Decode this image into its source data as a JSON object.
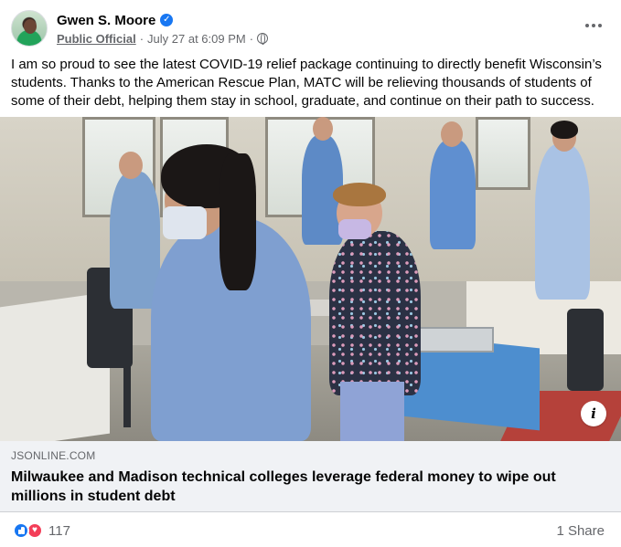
{
  "post": {
    "author": "Gwen S. Moore",
    "role": "Public Official",
    "date": "July 27 at 6:09 PM",
    "separator": "·",
    "text": "I am so proud to see the latest COVID-19 relief package continuing to directly benefit Wisconsin’s students. Thanks to the American Rescue Plan, MATC will be relieving thousands of students of some of their debt, helping them stay in school, graduate, and continue on their path to success."
  },
  "link": {
    "source": "JSONLINE.COM",
    "title": "Milwaukee and Madison technical colleges leverage federal money to wipe out millions in student debt"
  },
  "footer": {
    "reaction_count": "117",
    "share_count": "1 Share"
  },
  "icons": {
    "verified": "verified-badge-icon",
    "privacy": "globe-icon",
    "more": "more-options-icon",
    "info": "info-icon",
    "reactions": [
      "like-icon",
      "love-icon"
    ]
  },
  "colors": {
    "accent": "#1877f2",
    "love": "#f33e58",
    "secondary_text": "#65676b",
    "link_bg": "#f0f2f5"
  }
}
